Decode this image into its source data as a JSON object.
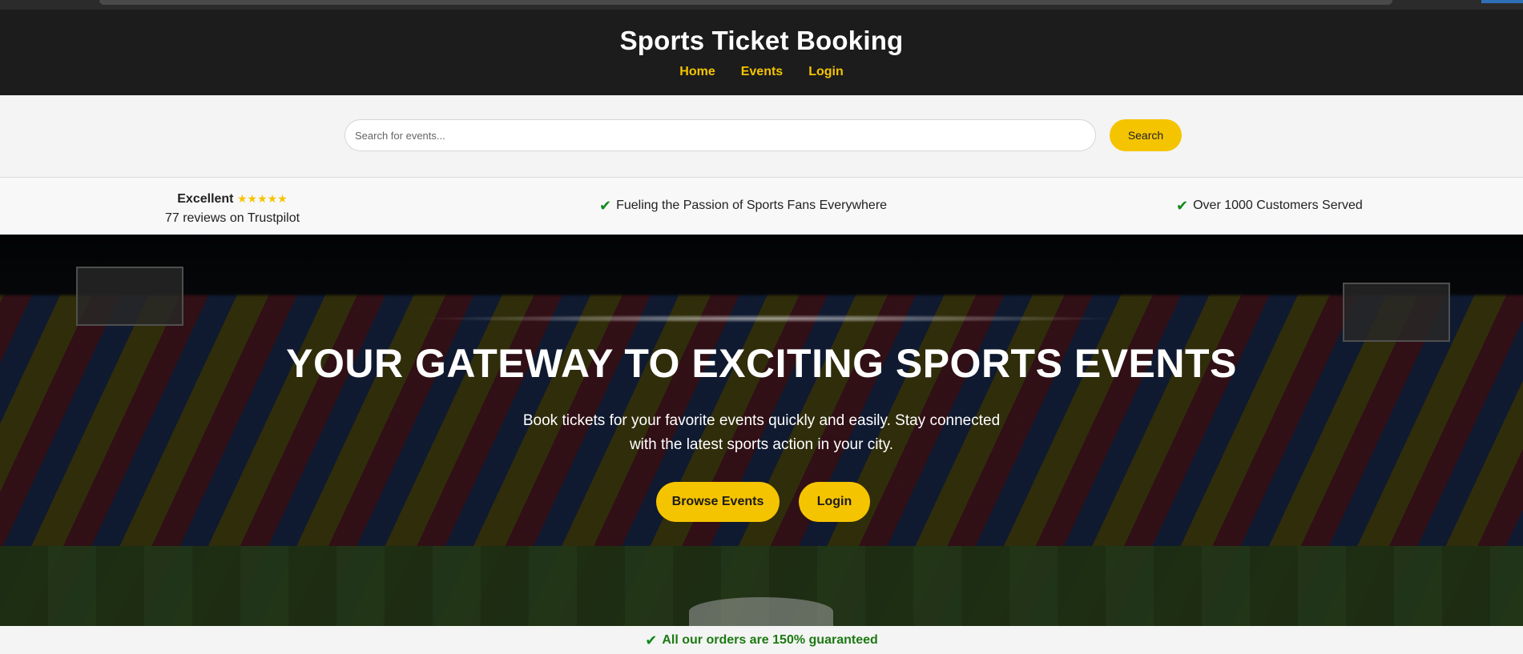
{
  "header": {
    "title": "Sports Ticket Booking",
    "nav": [
      {
        "label": "Home"
      },
      {
        "label": "Events"
      },
      {
        "label": "Login"
      }
    ]
  },
  "search": {
    "placeholder": "Search for events...",
    "value": "",
    "button_label": "Search"
  },
  "trust": {
    "rating_label": "Excellent",
    "stars": "★★★★★",
    "reviews": "77 reviews on Trustpilot",
    "items": [
      {
        "icon": "check-icon",
        "text": "Fueling the Passion of Sports Fans Everywhere"
      },
      {
        "icon": "check-icon",
        "text": "Over 1000 Customers Served"
      }
    ]
  },
  "hero": {
    "title": "YOUR GATEWAY TO EXCITING SPORTS EVENTS",
    "subtitle_line1": "Book tickets for your favorite events quickly and easily. Stay connected",
    "subtitle_line2": "with the latest sports action in your city.",
    "buttons": [
      {
        "label": "Browse Events"
      },
      {
        "label": "Login"
      }
    ]
  },
  "guarantee": {
    "icon": "check-icon",
    "text": "All our orders are 150% guaranteed"
  },
  "colors": {
    "accent": "#f5c400",
    "header_bg": "#1c1c1c",
    "check": "#0f8a1a",
    "guarantee_text": "#1c7a12"
  }
}
